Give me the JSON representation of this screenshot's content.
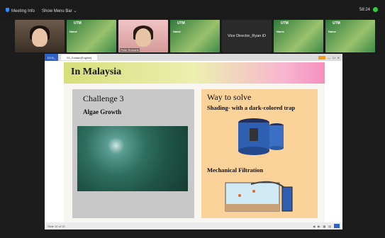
{
  "meeting": {
    "info_label": "Meeting Info",
    "menu_bar_label": "Show Menu Bar",
    "timer": "58:24"
  },
  "participants": [
    {
      "name": "",
      "type": "person"
    },
    {
      "name": "",
      "type": "poster",
      "poster_text": "Name"
    },
    {
      "name": "Peter Romanti",
      "type": "person-pink"
    },
    {
      "name": "",
      "type": "poster",
      "poster_text": "Name"
    },
    {
      "name": "Vice Director_Ryan iD",
      "type": "dark"
    },
    {
      "name": "",
      "type": "poster",
      "poster_text": "Name"
    },
    {
      "name": "",
      "type": "poster",
      "poster_text": "Name"
    }
  ],
  "poster_badge": "UTM",
  "window": {
    "tab_label": "03_Dulaan(English)",
    "left_tab": "DCG_"
  },
  "slide": {
    "banner_title": "In Malaysia",
    "left": {
      "heading": "Challenge 3",
      "subheading": "Algae Growth"
    },
    "right": {
      "heading": "Way to solve",
      "item1": "Shading- with a dark-colored trap",
      "item2": "Mechanical Filtration"
    }
  },
  "footer": {
    "slide_info": "Slide 10 of 13"
  },
  "colors": {
    "banner_start": "#d6df7a",
    "banner_end": "#f58fbe",
    "left_card": "#c8c8c8",
    "right_card": "#fbd29a",
    "accent": "#2d63c8",
    "record": "#2ecc40"
  }
}
